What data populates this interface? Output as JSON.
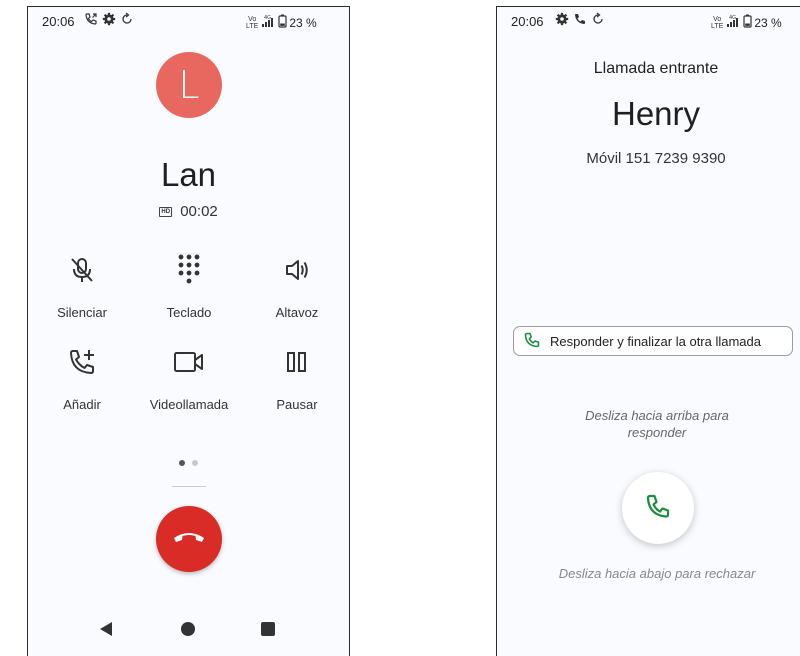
{
  "left_screen": {
    "status_bar": {
      "time": "20:06",
      "network_top": "Vo",
      "network_bottom": "LTE",
      "signal_tech": "4G",
      "battery": "23 %"
    },
    "avatar_letter": "L",
    "caller_name": "Lan",
    "hd_badge": "HD",
    "call_duration": "00:02",
    "controls": {
      "mute": "Silenciar",
      "keypad": "Teclado",
      "speaker": "Altavoz",
      "add": "Añadir",
      "video": "Videollamada",
      "pause": "Pausar"
    },
    "colors": {
      "avatar": "#e8685f",
      "end_call": "#d92c27"
    }
  },
  "right_screen": {
    "status_bar": {
      "time": "20:06",
      "network_top": "Vo",
      "network_bottom": "LTE",
      "signal_tech": "4G",
      "battery": "23 %"
    },
    "incoming_label": "Llamada entrante",
    "caller_name": "Henry",
    "caller_number": "Móvil 151 7239 9390",
    "answer_end_chip": "Responder y finalizar la otra llamada",
    "swipe_up_hint": "Desliza hacia arriba para responder",
    "swipe_down_hint": "Desliza hacia abajo para rechazar",
    "colors": {
      "answer": "#1e8e3e"
    }
  }
}
